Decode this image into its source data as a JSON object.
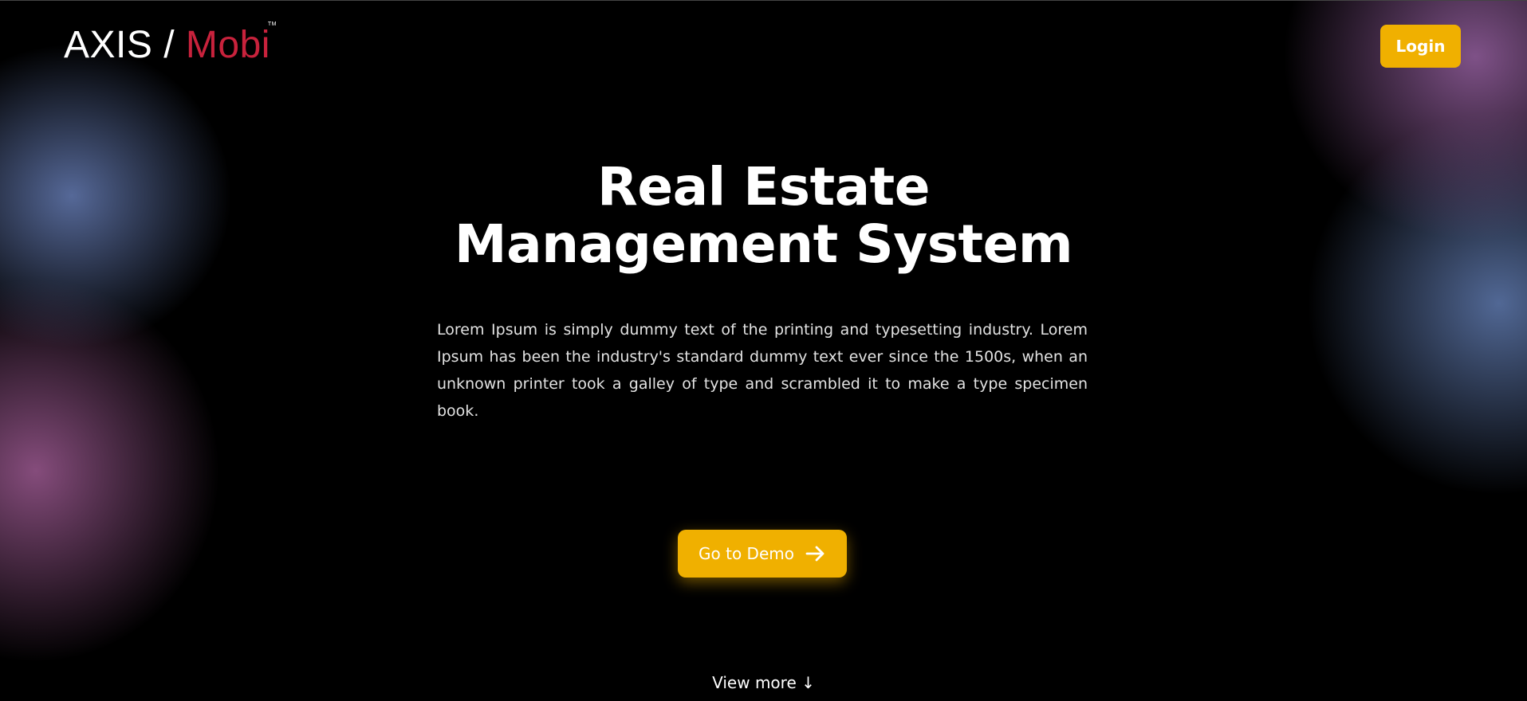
{
  "header": {
    "brand_main": "AXIS",
    "brand_sep": " / ",
    "brand_accent": "Mobi",
    "brand_tm": "TM",
    "login_label": "Login"
  },
  "hero": {
    "title_line1": "Real Estate",
    "title_line2": "Management System",
    "description": "Lorem Ipsum is simply dummy text of the printing and typesetting industry. Lorem Ipsum has been the industry's standard dummy text ever since the 1500s, when an unknown printer took a galley of type and scrambled it to make a type specimen book.",
    "demo_label": "Go to Demo",
    "demo_icon": "arrow-right-icon",
    "view_more_label": "View more ↓"
  },
  "colors": {
    "accent": "#f0b000",
    "brand_accent": "#c8223c",
    "background": "#000000"
  }
}
